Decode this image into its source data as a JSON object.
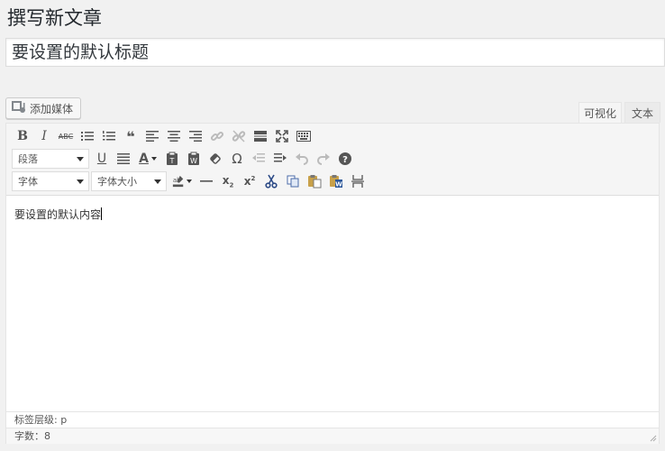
{
  "page": {
    "title": "撰写新文章"
  },
  "post": {
    "title_value": "要设置的默认标题",
    "content": "要设置的默认内容"
  },
  "media": {
    "button_label": "添加媒体",
    "icon": "media-icon"
  },
  "tabs": {
    "visual": "可视化",
    "text": "文本"
  },
  "toolbar": {
    "format_select": "段落",
    "font_select": "字体",
    "size_select": "字体大小"
  },
  "status": {
    "path": "标签层级: p",
    "word_count": "字数：8"
  }
}
